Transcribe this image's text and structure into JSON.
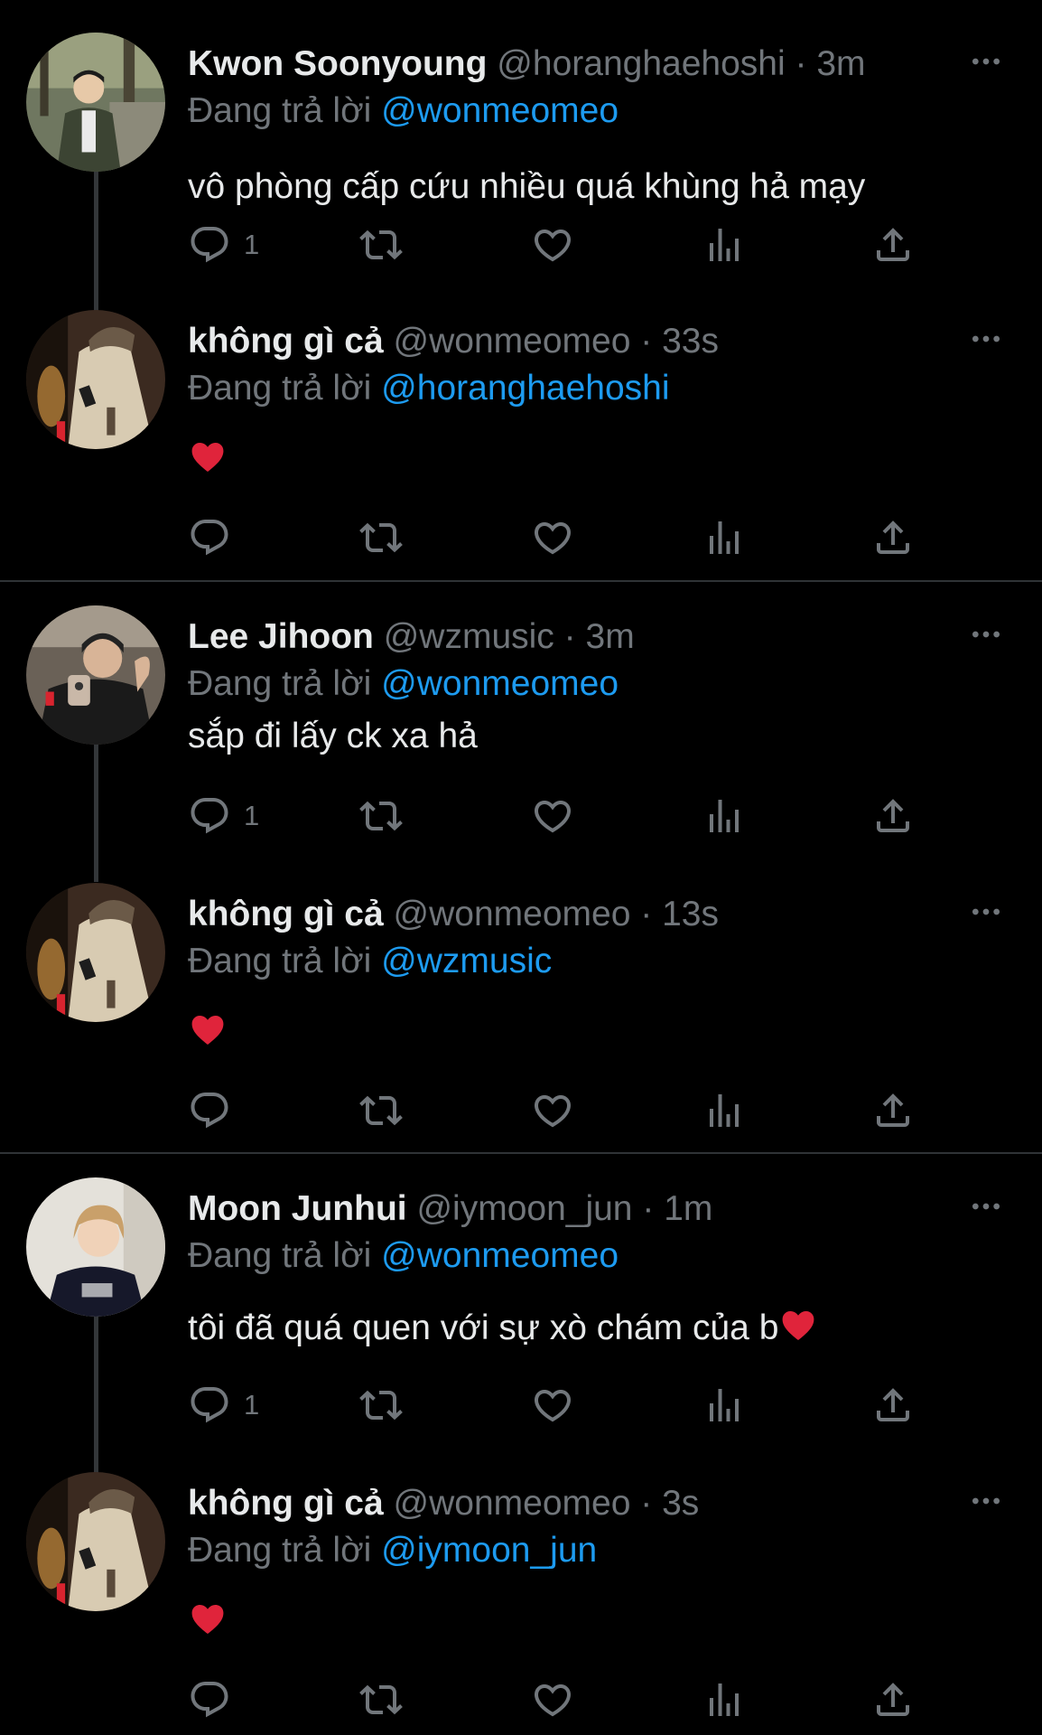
{
  "reply_prefix": "Đang trả lời",
  "separator": "·",
  "icons": {
    "reply": "reply-icon",
    "retweet": "retweet-icon",
    "like": "heart-icon",
    "views": "analytics-icon",
    "share": "share-icon",
    "more": "more-icon"
  },
  "colors": {
    "background": "#000000",
    "text": "#e7e9ea",
    "secondary": "#71767b",
    "link": "#1d9bf0",
    "heart_emoji": "#e0243b"
  },
  "tweets": [
    {
      "name": "Kwon Soonyoung",
      "handle": "@horanghaehoshi",
      "time": "3m",
      "replying_to": "@wonmeomeo",
      "text": "vô phòng cấp cứu nhiều quá khùng hả mạy",
      "reply_count": "1"
    },
    {
      "name": "không gì cả",
      "handle": "@wonmeomeo",
      "time": "33s",
      "replying_to": "@horanghaehoshi",
      "text": "❤️",
      "reply_count": ""
    },
    {
      "name": "Lee Jihoon",
      "handle": "@wzmusic",
      "time": "3m",
      "replying_to": "@wonmeomeo",
      "text": "sắp đi lấy ck xa hả",
      "reply_count": "1"
    },
    {
      "name": "không gì cả",
      "handle": "@wonmeomeo",
      "time": "13s",
      "replying_to": "@wzmusic",
      "text": "❤️",
      "reply_count": ""
    },
    {
      "name": "Moon Junhui",
      "handle": "@iymoon_jun",
      "time": "1m",
      "replying_to": "@wonmeomeo",
      "text": "tôi đã quá quen với sự xò chám của b",
      "text_emoji": "❤️",
      "reply_count": "1"
    },
    {
      "name": "không gì cả",
      "handle": "@wonmeomeo",
      "time": "3s",
      "replying_to": "@iymoon_jun",
      "text": "❤️",
      "reply_count": ""
    }
  ]
}
